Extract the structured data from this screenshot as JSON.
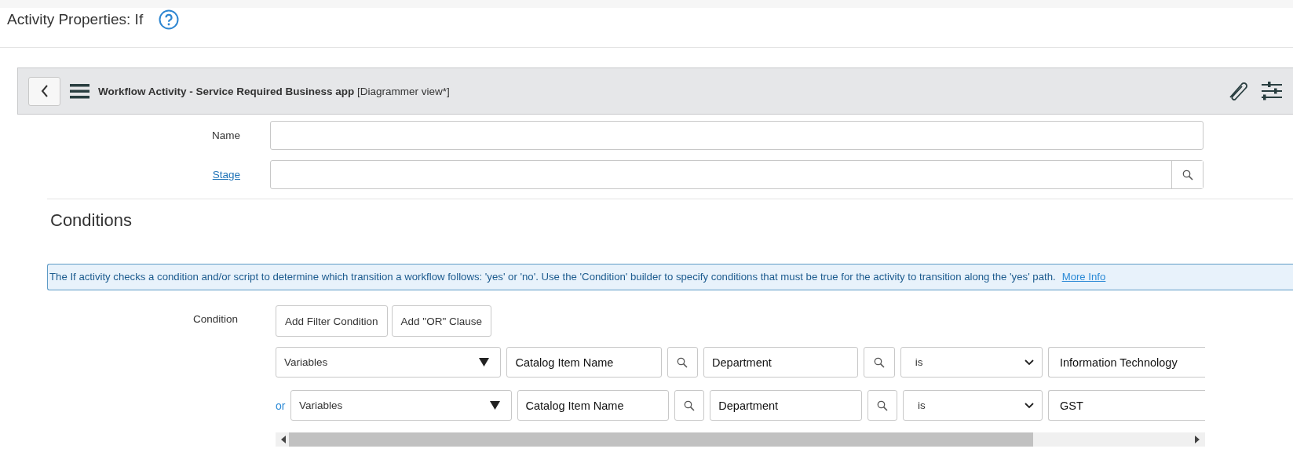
{
  "page_title": "Activity Properties: If",
  "header": {
    "title": "Workflow Activity - Service Required Business app",
    "view": "[Diagrammer view*]"
  },
  "form": {
    "fields": [
      {
        "label": "Name",
        "kind": "text"
      },
      {
        "label": "Stage",
        "kind": "reference"
      }
    ]
  },
  "conditions": {
    "heading": "Conditions",
    "info": "The If activity checks a condition and/or script to determine which transition a workflow follows: 'yes' or 'no'. Use the 'Condition' builder to specify conditions that must be true for the activity to transition along the 'yes' path.",
    "info_link": "More Info",
    "condition_label": "Condition",
    "buttons": [
      "Add Filter Condition",
      "Add \"OR\" Clause"
    ],
    "rows": [
      {
        "source": "Variables",
        "variable": "Catalog Item Name",
        "field": "Department",
        "operator": "is",
        "value": "Information Technology"
      },
      {
        "connector": "or",
        "source": "Variables",
        "variable": "Catalog Item Name",
        "field": "Department",
        "operator": "is",
        "value": "GST"
      }
    ]
  }
}
